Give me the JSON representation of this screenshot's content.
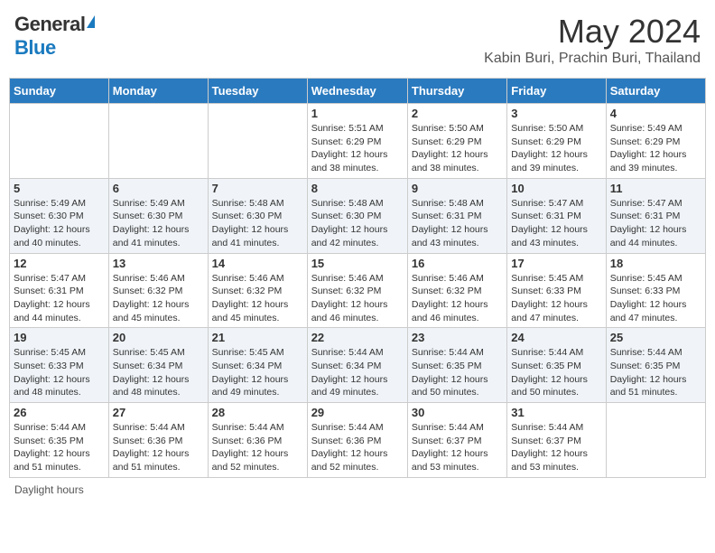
{
  "header": {
    "logo_general": "General",
    "logo_blue": "Blue",
    "title": "May 2024",
    "subtitle": "Kabin Buri, Prachin Buri, Thailand"
  },
  "days_of_week": [
    "Sunday",
    "Monday",
    "Tuesday",
    "Wednesday",
    "Thursday",
    "Friday",
    "Saturday"
  ],
  "weeks": [
    {
      "days": [
        {
          "num": "",
          "info": ""
        },
        {
          "num": "",
          "info": ""
        },
        {
          "num": "",
          "info": ""
        },
        {
          "num": "1",
          "info": "Sunrise: 5:51 AM\nSunset: 6:29 PM\nDaylight: 12 hours and 38 minutes."
        },
        {
          "num": "2",
          "info": "Sunrise: 5:50 AM\nSunset: 6:29 PM\nDaylight: 12 hours and 38 minutes."
        },
        {
          "num": "3",
          "info": "Sunrise: 5:50 AM\nSunset: 6:29 PM\nDaylight: 12 hours and 39 minutes."
        },
        {
          "num": "4",
          "info": "Sunrise: 5:49 AM\nSunset: 6:29 PM\nDaylight: 12 hours and 39 minutes."
        }
      ],
      "alt": false
    },
    {
      "days": [
        {
          "num": "5",
          "info": "Sunrise: 5:49 AM\nSunset: 6:30 PM\nDaylight: 12 hours and 40 minutes."
        },
        {
          "num": "6",
          "info": "Sunrise: 5:49 AM\nSunset: 6:30 PM\nDaylight: 12 hours and 41 minutes."
        },
        {
          "num": "7",
          "info": "Sunrise: 5:48 AM\nSunset: 6:30 PM\nDaylight: 12 hours and 41 minutes."
        },
        {
          "num": "8",
          "info": "Sunrise: 5:48 AM\nSunset: 6:30 PM\nDaylight: 12 hours and 42 minutes."
        },
        {
          "num": "9",
          "info": "Sunrise: 5:48 AM\nSunset: 6:31 PM\nDaylight: 12 hours and 43 minutes."
        },
        {
          "num": "10",
          "info": "Sunrise: 5:47 AM\nSunset: 6:31 PM\nDaylight: 12 hours and 43 minutes."
        },
        {
          "num": "11",
          "info": "Sunrise: 5:47 AM\nSunset: 6:31 PM\nDaylight: 12 hours and 44 minutes."
        }
      ],
      "alt": true
    },
    {
      "days": [
        {
          "num": "12",
          "info": "Sunrise: 5:47 AM\nSunset: 6:31 PM\nDaylight: 12 hours and 44 minutes."
        },
        {
          "num": "13",
          "info": "Sunrise: 5:46 AM\nSunset: 6:32 PM\nDaylight: 12 hours and 45 minutes."
        },
        {
          "num": "14",
          "info": "Sunrise: 5:46 AM\nSunset: 6:32 PM\nDaylight: 12 hours and 45 minutes."
        },
        {
          "num": "15",
          "info": "Sunrise: 5:46 AM\nSunset: 6:32 PM\nDaylight: 12 hours and 46 minutes."
        },
        {
          "num": "16",
          "info": "Sunrise: 5:46 AM\nSunset: 6:32 PM\nDaylight: 12 hours and 46 minutes."
        },
        {
          "num": "17",
          "info": "Sunrise: 5:45 AM\nSunset: 6:33 PM\nDaylight: 12 hours and 47 minutes."
        },
        {
          "num": "18",
          "info": "Sunrise: 5:45 AM\nSunset: 6:33 PM\nDaylight: 12 hours and 47 minutes."
        }
      ],
      "alt": false
    },
    {
      "days": [
        {
          "num": "19",
          "info": "Sunrise: 5:45 AM\nSunset: 6:33 PM\nDaylight: 12 hours and 48 minutes."
        },
        {
          "num": "20",
          "info": "Sunrise: 5:45 AM\nSunset: 6:34 PM\nDaylight: 12 hours and 48 minutes."
        },
        {
          "num": "21",
          "info": "Sunrise: 5:45 AM\nSunset: 6:34 PM\nDaylight: 12 hours and 49 minutes."
        },
        {
          "num": "22",
          "info": "Sunrise: 5:44 AM\nSunset: 6:34 PM\nDaylight: 12 hours and 49 minutes."
        },
        {
          "num": "23",
          "info": "Sunrise: 5:44 AM\nSunset: 6:35 PM\nDaylight: 12 hours and 50 minutes."
        },
        {
          "num": "24",
          "info": "Sunrise: 5:44 AM\nSunset: 6:35 PM\nDaylight: 12 hours and 50 minutes."
        },
        {
          "num": "25",
          "info": "Sunrise: 5:44 AM\nSunset: 6:35 PM\nDaylight: 12 hours and 51 minutes."
        }
      ],
      "alt": true
    },
    {
      "days": [
        {
          "num": "26",
          "info": "Sunrise: 5:44 AM\nSunset: 6:35 PM\nDaylight: 12 hours and 51 minutes."
        },
        {
          "num": "27",
          "info": "Sunrise: 5:44 AM\nSunset: 6:36 PM\nDaylight: 12 hours and 51 minutes."
        },
        {
          "num": "28",
          "info": "Sunrise: 5:44 AM\nSunset: 6:36 PM\nDaylight: 12 hours and 52 minutes."
        },
        {
          "num": "29",
          "info": "Sunrise: 5:44 AM\nSunset: 6:36 PM\nDaylight: 12 hours and 52 minutes."
        },
        {
          "num": "30",
          "info": "Sunrise: 5:44 AM\nSunset: 6:37 PM\nDaylight: 12 hours and 53 minutes."
        },
        {
          "num": "31",
          "info": "Sunrise: 5:44 AM\nSunset: 6:37 PM\nDaylight: 12 hours and 53 minutes."
        },
        {
          "num": "",
          "info": ""
        }
      ],
      "alt": false
    }
  ],
  "footer": {
    "note": "Daylight hours"
  }
}
